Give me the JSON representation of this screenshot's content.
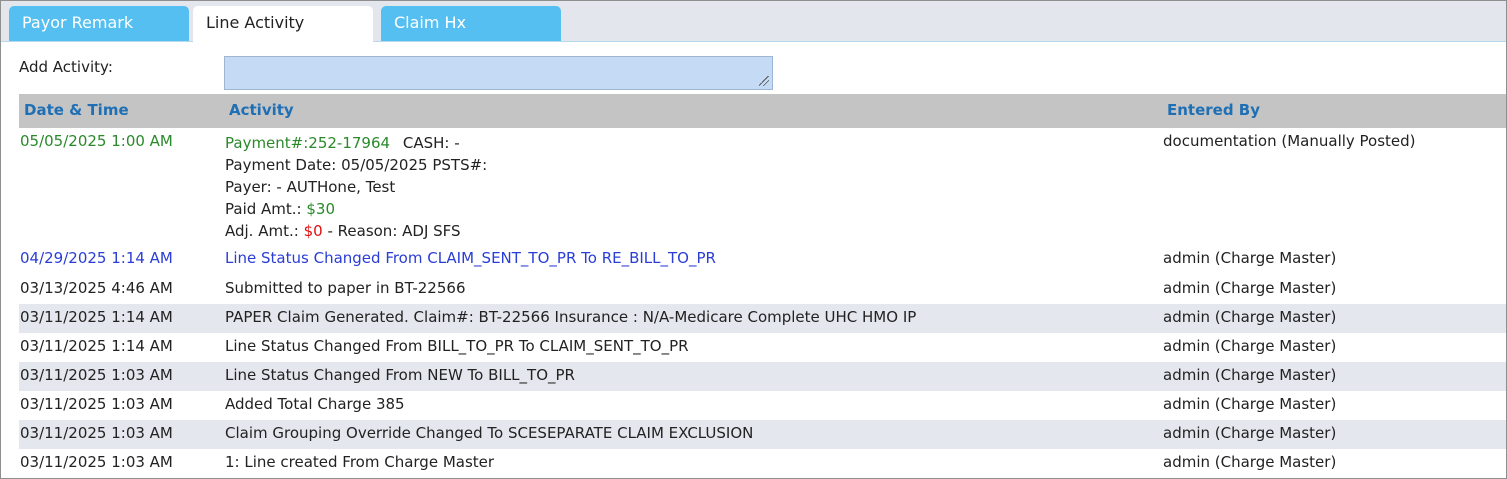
{
  "tabs": [
    {
      "label": "Payor Remark",
      "active": false
    },
    {
      "label": "Line Activity",
      "active": true
    },
    {
      "label": "Claim Hx",
      "active": false
    }
  ],
  "add_activity": {
    "label": "Add Activity:",
    "value": ""
  },
  "table": {
    "headers": [
      "Date & Time",
      "Activity",
      "Entered By"
    ],
    "payment_row": {
      "date": "05/05/2025 1:00 AM",
      "payment_link": "Payment#:252-17964",
      "cash_text": "CASH: -",
      "payment_date_line": "Payment Date: 05/05/2025 PSTS#:",
      "payer_line": "Payer: - AUTHone, Test",
      "paid_label": "Paid Amt.:",
      "paid_value": "$30",
      "adj_label": "Adj. Amt.:",
      "adj_value": "$0",
      "adj_reason": "- Reason: ADJ SFS",
      "entered_by": "documentation (Manually Posted)"
    },
    "rows": [
      {
        "date": "04/29/2025 1:14 AM",
        "activity": "Line Status Changed From CLAIM_SENT_TO_PR To RE_BILL_TO_PR",
        "entered_by": "admin (Charge Master)"
      },
      {
        "date": "03/13/2025 4:46 AM",
        "activity": "Submitted to paper in BT-22566",
        "entered_by": "admin (Charge Master)"
      },
      {
        "date": "03/11/2025 1:14 AM",
        "activity": "PAPER Claim Generated. Claim#: BT-22566 Insurance : N/A-Medicare Complete UHC HMO IP",
        "entered_by": "admin (Charge Master)"
      },
      {
        "date": "03/11/2025 1:14 AM",
        "activity": "Line Status Changed From BILL_TO_PR To CLAIM_SENT_TO_PR",
        "entered_by": "admin (Charge Master)"
      },
      {
        "date": "03/11/2025 1:03 AM",
        "activity": "Line Status Changed From NEW To BILL_TO_PR",
        "entered_by": "admin (Charge Master)"
      },
      {
        "date": "03/11/2025 1:03 AM",
        "activity": "Added Total Charge 385",
        "entered_by": "admin (Charge Master)"
      },
      {
        "date": "03/11/2025 1:03 AM",
        "activity": "Claim Grouping Override Changed To SCESEPARATE CLAIM EXCLUSION",
        "entered_by": "admin (Charge Master)"
      },
      {
        "date": "03/11/2025 1:03 AM",
        "activity": "1: Line created From Charge Master",
        "entered_by": "admin (Charge Master)"
      }
    ]
  },
  "colors": {
    "tab_inactive": "#55bff1",
    "header_text": "#1f6fb5",
    "payment_green": "#2a8a2a",
    "status_blue": "#2a3dd6",
    "adj_red": "#e01010"
  }
}
